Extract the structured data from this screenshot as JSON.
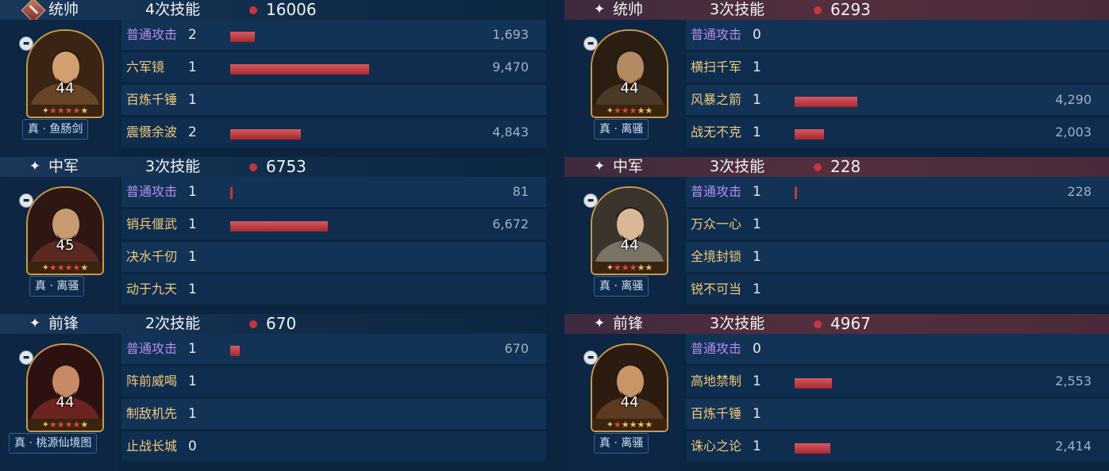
{
  "colors": {
    "bar": "#c8353a",
    "normal_attack": "#b48cf0",
    "skill_name": "#f0c87a",
    "left_header": "#19385a",
    "right_header": "#542f3e"
  },
  "teams": [
    {
      "side": "ours",
      "generals": [
        {
          "role": "统帅",
          "role_icon": "command-badge-icon",
          "skill_times": "4次技能",
          "total_damage": "16006",
          "level": "44",
          "stars_red": 4,
          "stars_total": 6,
          "equipment": "真 · 鱼肠剑",
          "skills": [
            {
              "name": "普通攻击",
              "type": "normal",
              "level": "2",
              "value": "1,693",
              "damage": 1693
            },
            {
              "name": "六军镜",
              "type": "skill",
              "level": "1",
              "value": "9,470",
              "damage": 9470
            },
            {
              "name": "百炼千锤",
              "type": "skill",
              "level": "1",
              "value": "",
              "damage": 0
            },
            {
              "name": "震慑余波",
              "type": "skill",
              "level": "2",
              "value": "4,843",
              "damage": 4843
            }
          ]
        },
        {
          "role": "中军",
          "role_icon": "sparkle-icon",
          "skill_times": "3次技能",
          "total_damage": "6753",
          "level": "45",
          "stars_red": 4,
          "stars_total": 6,
          "equipment": "真 · 离骚",
          "skills": [
            {
              "name": "普通攻击",
              "type": "normal",
              "level": "1",
              "value": "81",
              "damage": 81
            },
            {
              "name": "销兵偃武",
              "type": "skill",
              "level": "1",
              "value": "6,672",
              "damage": 6672
            },
            {
              "name": "决水千仞",
              "type": "skill",
              "level": "1",
              "value": "",
              "damage": 0
            },
            {
              "name": "动于九天",
              "type": "skill",
              "level": "1",
              "value": "",
              "damage": 0
            }
          ]
        },
        {
          "role": "前锋",
          "role_icon": "sparkle-icon",
          "skill_times": "2次技能",
          "total_damage": "670",
          "level": "44",
          "stars_red": 4,
          "stars_total": 6,
          "equipment": "真 · 桃源仙境图",
          "skills": [
            {
              "name": "普通攻击",
              "type": "normal",
              "level": "1",
              "value": "670",
              "damage": 670
            },
            {
              "name": "阵前威喝",
              "type": "skill",
              "level": "1",
              "value": "",
              "damage": 0
            },
            {
              "name": "制敌机先",
              "type": "skill",
              "level": "1",
              "value": "",
              "damage": 0
            },
            {
              "name": "止战长城",
              "type": "skill",
              "level": "0",
              "value": "",
              "damage": 0
            }
          ]
        }
      ]
    },
    {
      "side": "enemy",
      "generals": [
        {
          "role": "统帅",
          "role_icon": "sparkle-icon",
          "skill_times": "3次技能",
          "total_damage": "6293",
          "level": "44",
          "stars_red": 3,
          "stars_total": 6,
          "equipment": "真 · 离骚",
          "skills": [
            {
              "name": "普通攻击",
              "type": "normal",
              "level": "0",
              "value": "",
              "damage": 0
            },
            {
              "name": "横扫千军",
              "type": "skill",
              "level": "1",
              "value": "",
              "damage": 0
            },
            {
              "name": "风暴之箭",
              "type": "skill",
              "level": "1",
              "value": "4,290",
              "damage": 4290
            },
            {
              "name": "战无不克",
              "type": "skill",
              "level": "1",
              "value": "2,003",
              "damage": 2003
            }
          ]
        },
        {
          "role": "中军",
          "role_icon": "sparkle-icon",
          "skill_times": "3次技能",
          "total_damage": "228",
          "level": "44",
          "stars_red": 3,
          "stars_total": 6,
          "equipment": "真 · 离骚",
          "skills": [
            {
              "name": "普通攻击",
              "type": "normal",
              "level": "1",
              "value": "228",
              "damage": 228
            },
            {
              "name": "万众一心",
              "type": "skill",
              "level": "1",
              "value": "",
              "damage": 0
            },
            {
              "name": "全境封锁",
              "type": "skill",
              "level": "1",
              "value": "",
              "damage": 0
            },
            {
              "name": "锐不可当",
              "type": "skill",
              "level": "1",
              "value": "",
              "damage": 0
            }
          ]
        },
        {
          "role": "前锋",
          "role_icon": "sparkle-icon",
          "skill_times": "3次技能",
          "total_damage": "4967",
          "level": "44",
          "stars_red": 1,
          "stars_total": 6,
          "equipment": "真 · 离骚",
          "skills": [
            {
              "name": "普通攻击",
              "type": "normal",
              "level": "0",
              "value": "",
              "damage": 0
            },
            {
              "name": "高地禁制",
              "type": "skill",
              "level": "1",
              "value": "2,553",
              "damage": 2553
            },
            {
              "name": "百炼千锤",
              "type": "skill",
              "level": "1",
              "value": "",
              "damage": 0
            },
            {
              "name": "诛心之论",
              "type": "skill",
              "level": "1",
              "value": "2,414",
              "damage": 2414
            }
          ]
        }
      ]
    }
  ]
}
